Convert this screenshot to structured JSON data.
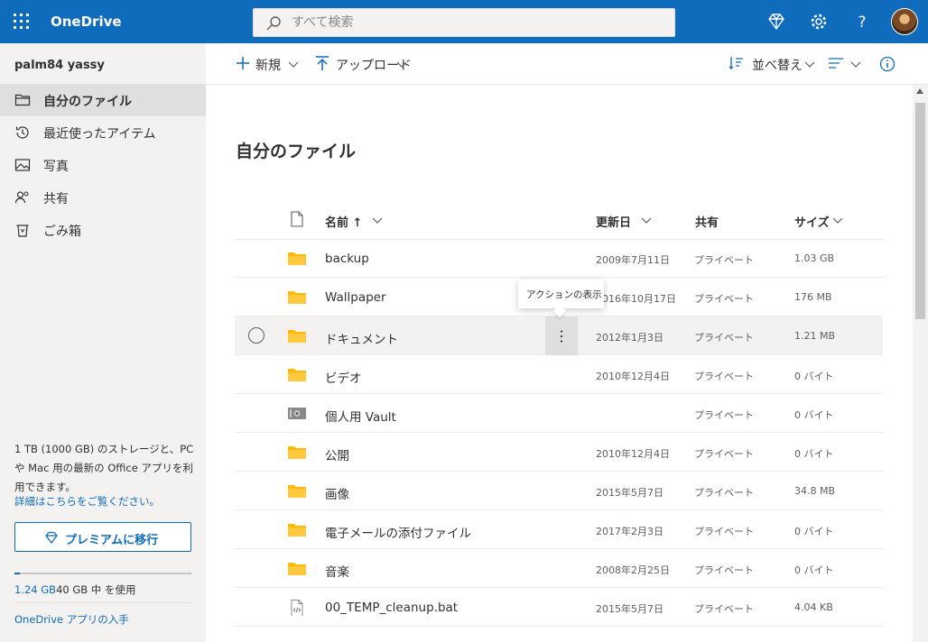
{
  "app": {
    "name": "OneDrive"
  },
  "search": {
    "placeholder": "すべて検索"
  },
  "user": {
    "name": "palm84 yassy"
  },
  "sidebar": {
    "items": [
      {
        "label": "自分のファイル",
        "icon": "folder-icon",
        "active": true
      },
      {
        "label": "最近使ったアイテム",
        "icon": "history-icon",
        "active": false
      },
      {
        "label": "写真",
        "icon": "photo-icon",
        "active": false
      },
      {
        "label": "共有",
        "icon": "people-icon",
        "active": false
      },
      {
        "label": "ごみ箱",
        "icon": "recycle-bin-icon",
        "active": false
      }
    ],
    "storage_text": "1 TB (1000 GB) のストレージと、PC や Mac 用の最新の Office アプリを利用できます。",
    "storage_link": "詳細はこちらをご覧ください。",
    "premium_button": "プレミアムに移行",
    "usage_used": "1.24 GB",
    "usage_rest": "40 GB 中 を使用",
    "usage_fraction": 0.031,
    "app_link": "OneDrive アプリの入手"
  },
  "commandbar": {
    "new_label": "新規",
    "upload_label": "アップロード",
    "sort_label": "並べ替え"
  },
  "main": {
    "title": "自分のファイル"
  },
  "table": {
    "headers": {
      "name": "名前 ↑",
      "modified": "更新日",
      "sharing": "共有",
      "size": "サイズ"
    },
    "rows": [
      {
        "name": "backup",
        "type": "folder",
        "modified": "2009年7月11日",
        "sharing": "プライベート",
        "size": "1.03 GB"
      },
      {
        "name": "Wallpaper",
        "type": "folder",
        "modified": "2016年10月17日",
        "sharing": "プライベート",
        "size": "176 MB"
      },
      {
        "name": "ドキュメント",
        "type": "folder",
        "modified": "2012年1月3日",
        "sharing": "プライベート",
        "size": "1.21 MB"
      },
      {
        "name": "ビデオ",
        "type": "folder",
        "modified": "2010年12月4日",
        "sharing": "プライベート",
        "size": "0 バイト"
      },
      {
        "name": "個人用 Vault",
        "type": "vault",
        "modified": "",
        "sharing": "プライベート",
        "size": "0 バイト"
      },
      {
        "name": "公開",
        "type": "folder",
        "modified": "2010年12月4日",
        "sharing": "プライベート",
        "size": "0 バイト"
      },
      {
        "name": "画像",
        "type": "folder",
        "modified": "2015年5月7日",
        "sharing": "プライベート",
        "size": "34.8 MB"
      },
      {
        "name": "電子メールの添付ファイル",
        "type": "folder",
        "modified": "2017年2月3日",
        "sharing": "プライベート",
        "size": "0 バイト"
      },
      {
        "name": "音楽",
        "type": "folder",
        "modified": "2008年2月25日",
        "sharing": "プライベート",
        "size": "0 バイト"
      },
      {
        "name": "00_TEMP_cleanup.bat",
        "type": "file",
        "modified": "2015年5月7日",
        "sharing": "プライベート",
        "size": "4.04 KB"
      }
    ]
  },
  "tooltip": {
    "text": "アクションの表示"
  },
  "colors": {
    "brand": "#0f6cbd",
    "folder": "#ffb900",
    "sidebar_bg": "#f3f2f1"
  }
}
